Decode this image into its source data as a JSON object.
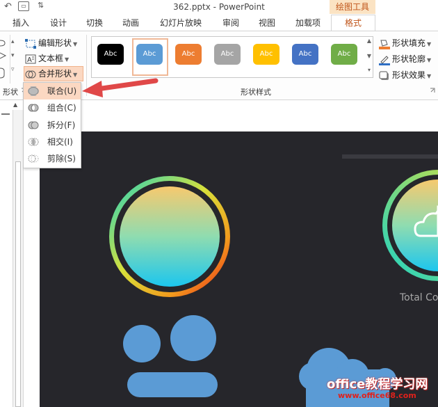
{
  "titlebar": {
    "title": "362.pptx - PowerPoint",
    "context_label": "绘图工具",
    "qa_more": "⇅"
  },
  "tabs": [
    "插入",
    "设计",
    "切换",
    "动画",
    "幻灯片放映",
    "审阅",
    "视图",
    "加载项"
  ],
  "active_tab": "格式",
  "ribbon": {
    "insert_shapes": {
      "edit_shape": "编辑形状",
      "text_box": "文本框",
      "merge_shapes": "合并形状",
      "group_label": "形状"
    },
    "shape_styles": {
      "group_label": "形状样式",
      "swatch_text": "Abc",
      "swatch_colors": [
        "#000000",
        "#5b9bd5",
        "#ed7d31",
        "#a5a5a5",
        "#ffc000",
        "#4472c4",
        "#70ad47"
      ],
      "selected_index": 1
    },
    "right_buttons": {
      "fill": "形状填充",
      "outline": "形状轮廓",
      "effects": "形状效果"
    }
  },
  "merge_menu": {
    "items": [
      "联合(U)",
      "组合(C)",
      "拆分(F)",
      "相交(I)",
      "剪除(S)"
    ],
    "highlighted_index": 0
  },
  "slide": {
    "background": "#26262b",
    "caption": "Total Co"
  },
  "watermark": {
    "line1": "office教程学习网",
    "line2": "www.office68.com"
  },
  "colors": {
    "accent": "#c0551a",
    "highlight": "#fbd8c2",
    "shape_blue": "#5b9bd5",
    "arrow_red": "#e04848"
  }
}
